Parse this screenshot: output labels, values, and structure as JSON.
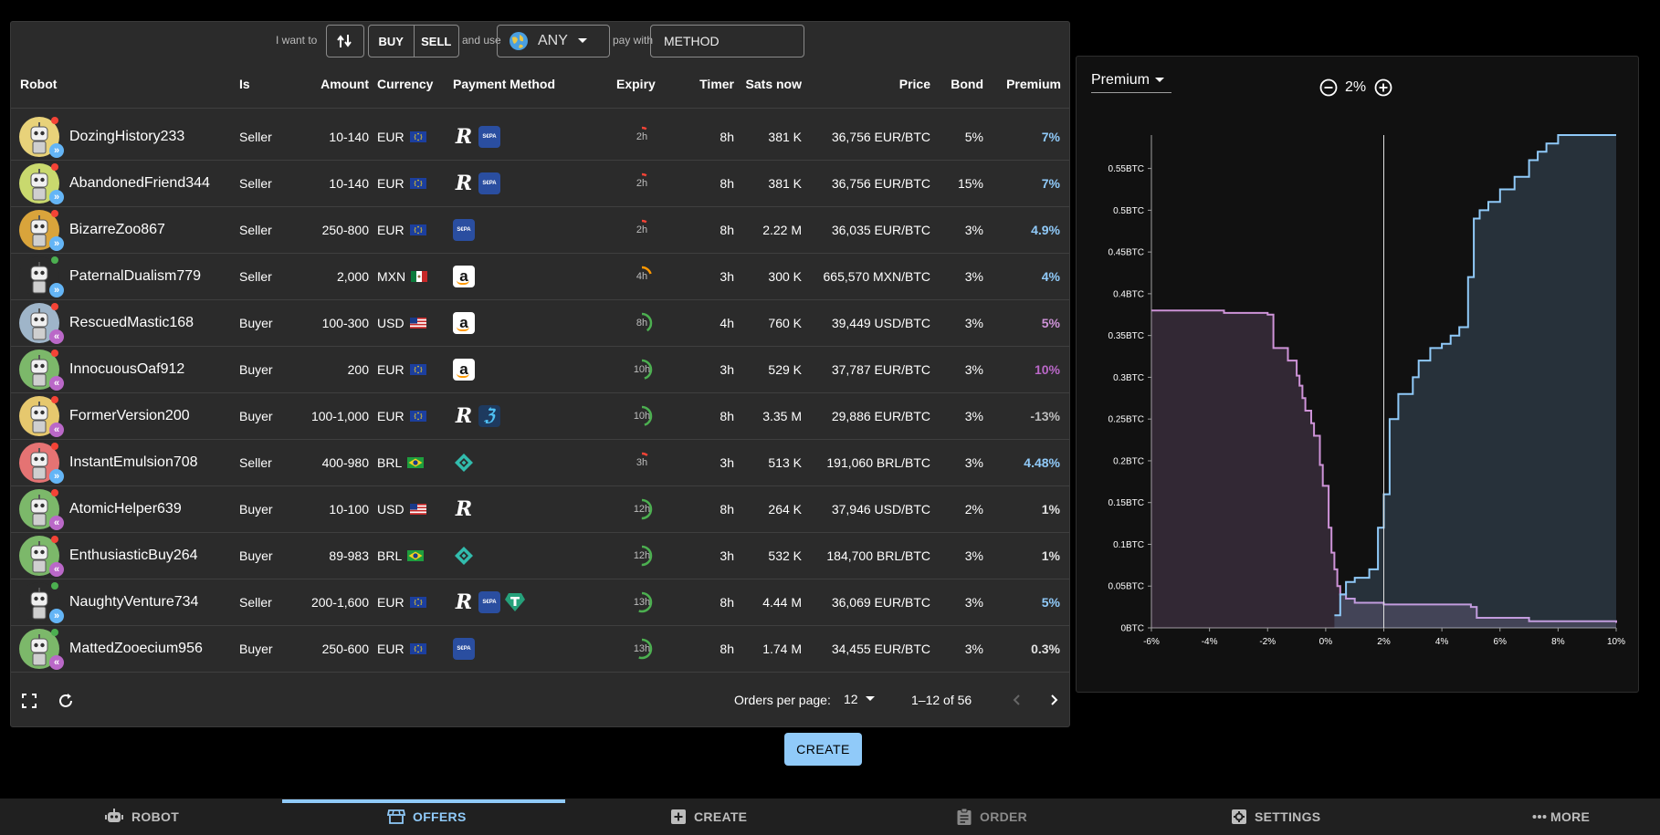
{
  "filters": {
    "i_want_to": "I want to",
    "buy": "BUY",
    "sell": "SELL",
    "and_use": "and use",
    "currency": "ANY",
    "pay_with": "pay with",
    "method_placeholder": "METHOD"
  },
  "columns": [
    "Robot",
    "Is",
    "Amount",
    "Currency",
    "Payment Method",
    "Expiry",
    "Timer",
    "Sats now",
    "Price",
    "Bond",
    "Premium"
  ],
  "orders": [
    {
      "robot": "DozingHistory233",
      "is": "Seller",
      "amount": "10-140",
      "currency": "EUR",
      "flag": "eu",
      "methods": [
        "revolut",
        "sepa"
      ],
      "expiry": "2h",
      "expiry_level": 0.08,
      "expiry_color": "#f44336",
      "timer": "8h",
      "sats": "381 K",
      "price": "36,756 EUR/BTC",
      "bond": "5%",
      "premium": "7%",
      "premium_color": "#90caf9",
      "avatar": "#e8d27a",
      "status": "#f44336",
      "side": "sell"
    },
    {
      "robot": "AbandonedFriend344",
      "is": "Seller",
      "amount": "10-140",
      "currency": "EUR",
      "flag": "eu",
      "methods": [
        "revolut",
        "sepa"
      ],
      "expiry": "2h",
      "expiry_level": 0.08,
      "expiry_color": "#f44336",
      "timer": "8h",
      "sats": "381 K",
      "price": "36,756 EUR/BTC",
      "bond": "15%",
      "premium": "7%",
      "premium_color": "#90caf9",
      "avatar": "#c9d96e",
      "status": "#f44336",
      "side": "sell"
    },
    {
      "robot": "BizarreZoo867",
      "is": "Seller",
      "amount": "250-800",
      "currency": "EUR",
      "flag": "eu",
      "methods": [
        "sepa"
      ],
      "expiry": "2h",
      "expiry_level": 0.08,
      "expiry_color": "#f44336",
      "timer": "8h",
      "sats": "2.22 M",
      "price": "36,035 EUR/BTC",
      "bond": "3%",
      "premium": "4.9%",
      "premium_color": "#90caf9",
      "avatar": "#d9a43b",
      "status": "#f44336",
      "side": "sell"
    },
    {
      "robot": "PaternalDualism779",
      "is": "Seller",
      "amount": "2,000",
      "currency": "MXN",
      "flag": "mx",
      "methods": [
        "amazon"
      ],
      "expiry": "4h",
      "expiry_level": 0.2,
      "expiry_color": "#ff9800",
      "timer": "3h",
      "sats": "300 K",
      "price": "665,570 MXN/BTC",
      "bond": "3%",
      "premium": "4%",
      "premium_color": "#90caf9",
      "avatar": "#2b2b2b",
      "status": "#4caf50",
      "side": "sell"
    },
    {
      "robot": "RescuedMastic168",
      "is": "Buyer",
      "amount": "100-300",
      "currency": "USD",
      "flag": "us",
      "methods": [
        "amazon"
      ],
      "expiry": "8h",
      "expiry_level": 0.4,
      "expiry_color": "#4caf50",
      "timer": "4h",
      "sats": "760 K",
      "price": "39,449 USD/BTC",
      "bond": "3%",
      "premium": "5%",
      "premium_color": "#ce93d8",
      "avatar": "#9fb5c9",
      "status": "#f44336",
      "side": "buy"
    },
    {
      "robot": "InnocuousOaf912",
      "is": "Buyer",
      "amount": "200",
      "currency": "EUR",
      "flag": "eu",
      "methods": [
        "amazon"
      ],
      "expiry": "10h",
      "expiry_level": 0.45,
      "expiry_color": "#4caf50",
      "timer": "3h",
      "sats": "529 K",
      "price": "37,787 EUR/BTC",
      "bond": "3%",
      "premium": "10%",
      "premium_color": "#ba68c8",
      "avatar": "#7cb86a",
      "status": "#f44336",
      "side": "buy"
    },
    {
      "robot": "FormerVersion200",
      "is": "Buyer",
      "amount": "100-1,000",
      "currency": "EUR",
      "flag": "eu",
      "methods": [
        "revolut",
        "strike"
      ],
      "expiry": "10h",
      "expiry_level": 0.45,
      "expiry_color": "#4caf50",
      "timer": "8h",
      "sats": "3.35 M",
      "price": "29,886 EUR/BTC",
      "bond": "3%",
      "premium": "-13%",
      "premium_color": "#bdbdbd",
      "avatar": "#e6c86e",
      "status": "#f44336",
      "side": "buy"
    },
    {
      "robot": "InstantEmulsion708",
      "is": "Seller",
      "amount": "400-980",
      "currency": "BRL",
      "flag": "br",
      "methods": [
        "pix"
      ],
      "expiry": "3h",
      "expiry_level": 0.1,
      "expiry_color": "#f44336",
      "timer": "3h",
      "sats": "513 K",
      "price": "191,060 BRL/BTC",
      "bond": "3%",
      "premium": "4.48%",
      "premium_color": "#90caf9",
      "avatar": "#e57373",
      "status": "#f44336",
      "side": "sell"
    },
    {
      "robot": "AtomicHelper639",
      "is": "Buyer",
      "amount": "10-100",
      "currency": "USD",
      "flag": "us",
      "methods": [
        "revolut"
      ],
      "expiry": "12h",
      "expiry_level": 0.5,
      "expiry_color": "#4caf50",
      "timer": "8h",
      "sats": "264 K",
      "price": "37,946 USD/BTC",
      "bond": "2%",
      "premium": "1%",
      "premium_color": "#e0e0e0",
      "avatar": "#7cb86a",
      "status": "#f44336",
      "side": "buy"
    },
    {
      "robot": "EnthusiasticBuy264",
      "is": "Buyer",
      "amount": "89-983",
      "currency": "BRL",
      "flag": "br",
      "methods": [
        "pix"
      ],
      "expiry": "12h",
      "expiry_level": 0.5,
      "expiry_color": "#4caf50",
      "timer": "3h",
      "sats": "532 K",
      "price": "184,700 BRL/BTC",
      "bond": "3%",
      "premium": "1%",
      "premium_color": "#e0e0e0",
      "avatar": "#7cb86a",
      "status": "#f44336",
      "side": "buy"
    },
    {
      "robot": "NaughtyVenture734",
      "is": "Seller",
      "amount": "200-1,600",
      "currency": "EUR",
      "flag": "eu",
      "methods": [
        "revolut",
        "sepa",
        "tether"
      ],
      "expiry": "13h",
      "expiry_level": 0.55,
      "expiry_color": "#4caf50",
      "timer": "8h",
      "sats": "4.44 M",
      "price": "36,069 EUR/BTC",
      "bond": "3%",
      "premium": "5%",
      "premium_color": "#90caf9",
      "avatar": "#2b2b2b",
      "status": "#4caf50",
      "side": "sell"
    },
    {
      "robot": "MattedZooecium956",
      "is": "Buyer",
      "amount": "250-600",
      "currency": "EUR",
      "flag": "eu",
      "methods": [
        "sepa"
      ],
      "expiry": "13h",
      "expiry_level": 0.55,
      "expiry_color": "#4caf50",
      "timer": "8h",
      "sats": "1.74 M",
      "price": "34,455 EUR/BTC",
      "bond": "3%",
      "premium": "0.3%",
      "premium_color": "#e0e0e0",
      "avatar": "#7cb86a",
      "status": "#4caf50",
      "side": "buy"
    }
  ],
  "footer": {
    "orders_per_page_label": "Orders per page:",
    "orders_per_page": "12",
    "range": "1–12 of 56"
  },
  "depth_chart": {
    "x_field": "Premium",
    "premium": "2%"
  },
  "chart_data": {
    "type": "area",
    "title": "",
    "xlabel": "",
    "ylabel": "",
    "xlim": [
      -6,
      10
    ],
    "ylim": [
      0,
      0.59
    ],
    "x_ticks": [
      "-6%",
      "-4%",
      "-2%",
      "0%",
      "2%",
      "4%",
      "6%",
      "8%",
      "10%"
    ],
    "y_ticks": [
      "0BTC",
      "0.05BTC",
      "0.1BTC",
      "0.15BTC",
      "0.2BTC",
      "0.25BTC",
      "0.3BTC",
      "0.35BTC",
      "0.4BTC",
      "0.45BTC",
      "0.5BTC",
      "0.55BTC"
    ],
    "center_premium": 2,
    "series": [
      {
        "name": "",
        "color": "#ce93d8",
        "x": [
          -6,
          -4.5,
          -3.5,
          -2,
          -1.8,
          -1.3,
          -1.0,
          -0.9,
          -0.8,
          -0.7,
          -0.5,
          -0.4,
          -0.2,
          -0.1,
          0.1,
          0.2,
          0.3,
          0.4,
          0.5,
          0.7,
          1.0,
          2.0,
          5.0,
          5.2,
          7.0,
          10
        ],
        "y": [
          0.38,
          0.38,
          0.377,
          0.375,
          0.335,
          0.32,
          0.302,
          0.29,
          0.275,
          0.26,
          0.245,
          0.23,
          0.195,
          0.17,
          0.12,
          0.09,
          0.07,
          0.05,
          0.04,
          0.035,
          0.03,
          0.028,
          0.025,
          0.012,
          0.008,
          0.006
        ]
      },
      {
        "name": "",
        "color": "#90caf9",
        "x": [
          0.3,
          0.5,
          0.7,
          1.0,
          1.5,
          1.8,
          2.0,
          2.2,
          2.5,
          3.0,
          3.2,
          3.6,
          4.0,
          4.3,
          4.6,
          4.9,
          5.1,
          5.3,
          5.6,
          6.0,
          6.5,
          7.0,
          7.3,
          7.6,
          8.0,
          8.8,
          10
        ],
        "y": [
          0.015,
          0.04,
          0.055,
          0.06,
          0.07,
          0.12,
          0.16,
          0.25,
          0.28,
          0.3,
          0.32,
          0.335,
          0.34,
          0.35,
          0.36,
          0.42,
          0.49,
          0.5,
          0.51,
          0.525,
          0.54,
          0.56,
          0.57,
          0.58,
          0.59,
          0.59,
          0.59
        ]
      }
    ]
  },
  "create_button": "CREATE",
  "nav": {
    "robot": "ROBOT",
    "offers": "OFFERS",
    "create": "CREATE",
    "order": "ORDER",
    "settings": "SETTINGS",
    "more": "MORE"
  }
}
